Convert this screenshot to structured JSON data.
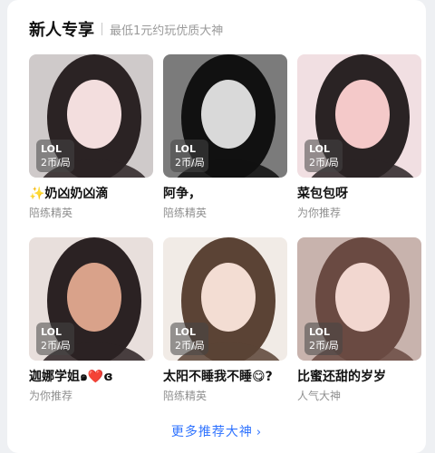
{
  "section": {
    "title": "新人专享",
    "subtitle": "最低1元约玩优质大神"
  },
  "players": [
    {
      "game": "LOL",
      "price": "2币/局",
      "name": "✨奶凶奶凶滴",
      "tag": "陪练精英",
      "palette": [
        "#cfcaca",
        "#2b2324",
        "#f3dede"
      ]
    },
    {
      "game": "LOL",
      "price": "2币/局",
      "name": "阿争，",
      "tag": "陪练精英",
      "palette": [
        "#7b7b7b",
        "#111111",
        "#d9d9d9"
      ]
    },
    {
      "game": "LOL",
      "price": "2币/局",
      "name": "菜包包呀",
      "tag": "为你推荐",
      "palette": [
        "#f1dfe2",
        "#2a2324",
        "#f4c9c9"
      ]
    },
    {
      "game": "LOL",
      "price": "2币/局",
      "name": "迦娜学姐๑❤️ɞ",
      "tag": "为你推荐",
      "palette": [
        "#e8dfdc",
        "#2b2223",
        "#d9a28a"
      ]
    },
    {
      "game": "LOL",
      "price": "2币/局",
      "name": "太阳不睡我不睡😋?",
      "tag": "陪练精英",
      "palette": [
        "#f1ebe6",
        "#5b4335",
        "#f3ddd3"
      ]
    },
    {
      "game": "LOL",
      "price": "2币/局",
      "name": "比蜜还甜的岁岁",
      "tag": "人气大神",
      "palette": [
        "#c8b3ad",
        "#6a4a42",
        "#f2d7d0"
      ]
    }
  ],
  "footer": {
    "more_label": "更多推荐大神",
    "chevron": "›"
  }
}
